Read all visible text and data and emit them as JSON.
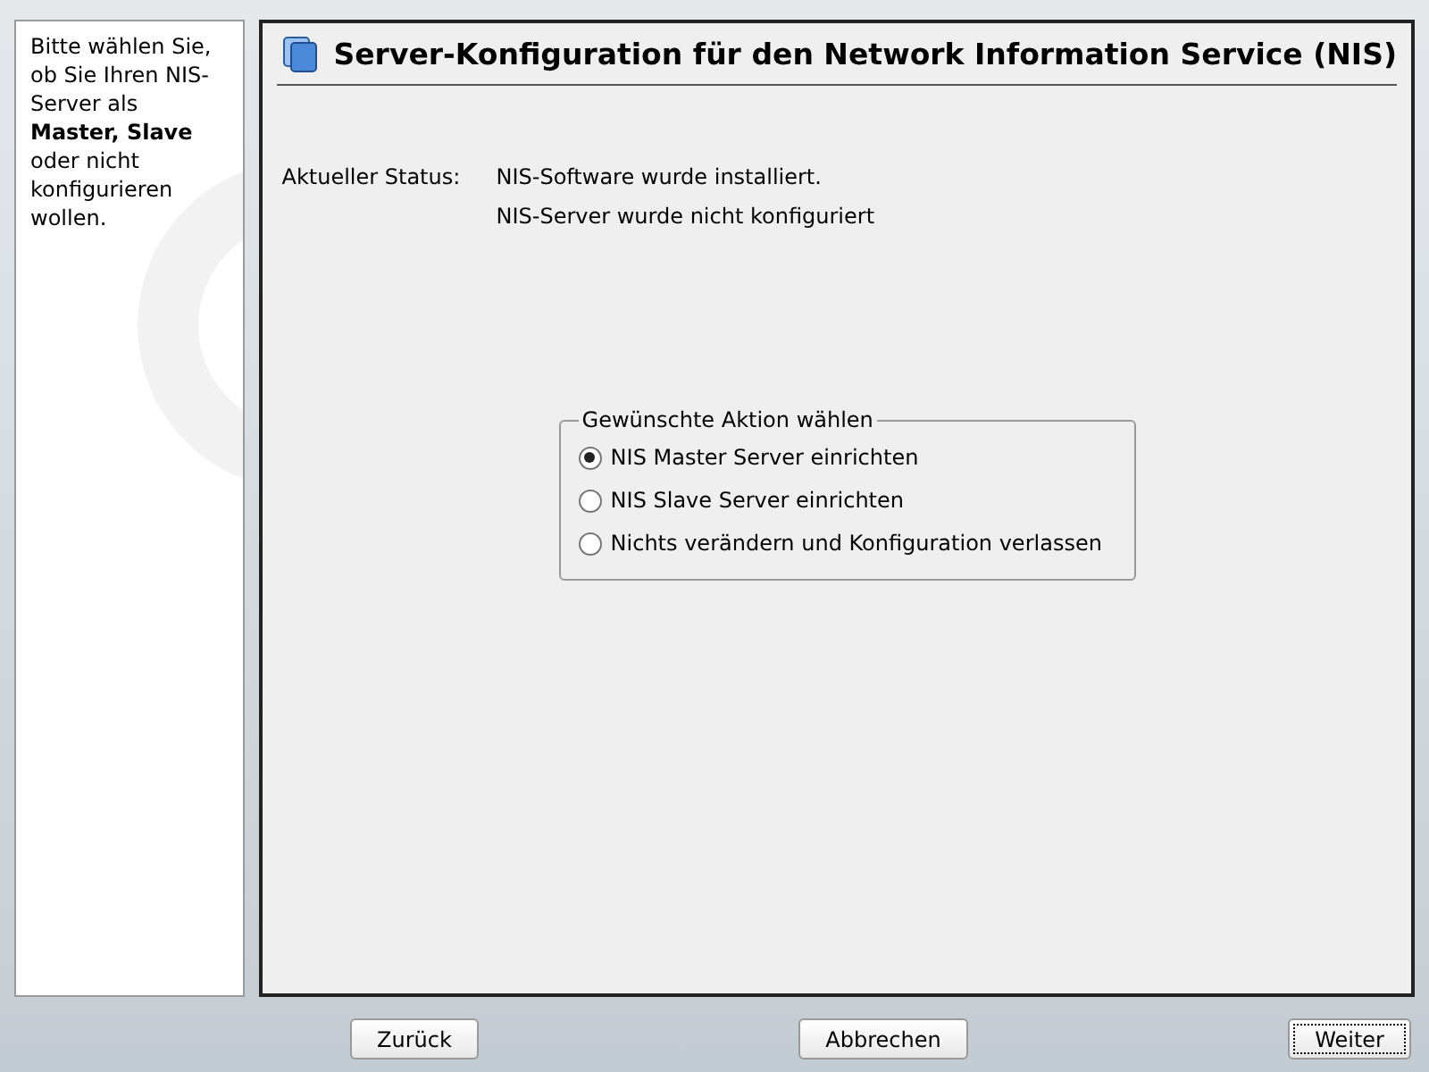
{
  "help_text": "Bitte wählen Sie, ob Sie Ihren NIS-Server als **Master, Slave** oder nicht konfigurieren wollen.",
  "title": "Server-Konfiguration für den Network Information Service (NIS)",
  "status": {
    "label": "Aktueller Status:",
    "lines": [
      "NIS-Software wurde installiert.",
      "NIS-Server wurde nicht konfiguriert"
    ]
  },
  "action_group": {
    "title": "Gewünschte Aktion wählen",
    "options": [
      {
        "label": "NIS Master Server einrichten",
        "selected": true
      },
      {
        "label": "NIS Slave Server einrichten",
        "selected": false
      },
      {
        "label": "Nichts verändern und Konfiguration verlassen",
        "selected": false
      }
    ]
  },
  "buttons": [
    {
      "label": "Zurück",
      "focused": false
    },
    {
      "label": "Abbrechen",
      "focused": false
    },
    {
      "label": "Weiter",
      "focused": true
    }
  ]
}
